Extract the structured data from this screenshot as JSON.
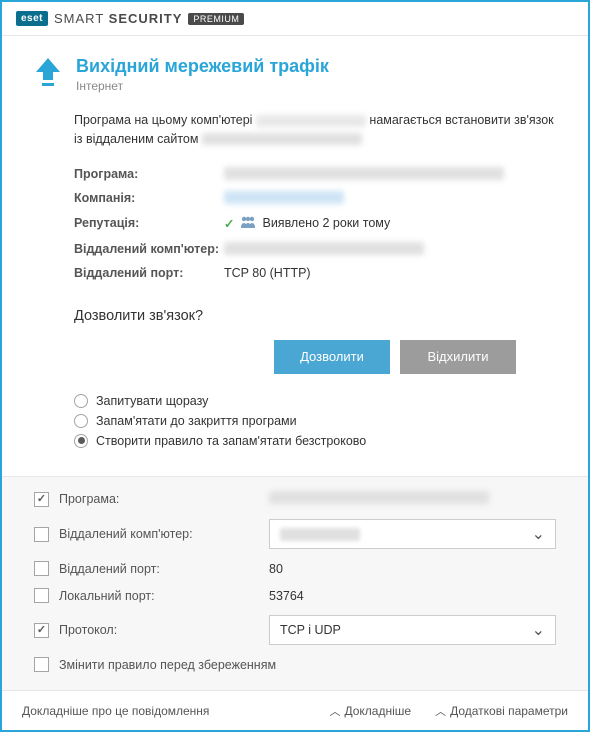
{
  "titlebar": {
    "brand_badge": "eset",
    "product_light": "SMART ",
    "product_bold": "SECURITY",
    "premium": "PREMIUM"
  },
  "header": {
    "title": "Вихідний мережевий трафік",
    "subtitle": "Інтернет"
  },
  "intro": {
    "part1": "Програма на цьому комп'ютері ",
    "part2": " намагається встановити зв'язок із віддаленим сайтом "
  },
  "info": {
    "program_label": "Програма:",
    "company_label": "Компанія:",
    "reputation_label": "Репутація:",
    "reputation_value": "Виявлено 2 роки тому",
    "remote_host_label": "Віддалений комп'ютер:",
    "remote_port_label": "Віддалений порт:",
    "remote_port_value": "TCP 80 (HTTP)"
  },
  "question": "Дозволити зв'язок?",
  "buttons": {
    "allow": "Дозволити",
    "deny": "Відхилити"
  },
  "radios": {
    "ask": "Запитувати щоразу",
    "until_close": "Запам'ятати до закриття програми",
    "create_rule": "Створити правило та запам'ятати безстроково",
    "selected": "create_rule"
  },
  "rule": {
    "program": {
      "label": "Програма:",
      "checked": true
    },
    "remote_host": {
      "label": "Віддалений комп'ютер:",
      "checked": false
    },
    "remote_port": {
      "label": "Віддалений порт:",
      "checked": false,
      "value": "80"
    },
    "local_port": {
      "label": "Локальний порт:",
      "checked": false,
      "value": "53764"
    },
    "protocol": {
      "label": "Протокол:",
      "checked": true,
      "value": "TCP і UDP"
    },
    "modify": {
      "label": "Змінити правило перед збереженням",
      "checked": false
    }
  },
  "footer": {
    "details_link": "Докладніше про це повідомлення",
    "more": "Докладніше",
    "advanced": "Додаткові параметри"
  }
}
